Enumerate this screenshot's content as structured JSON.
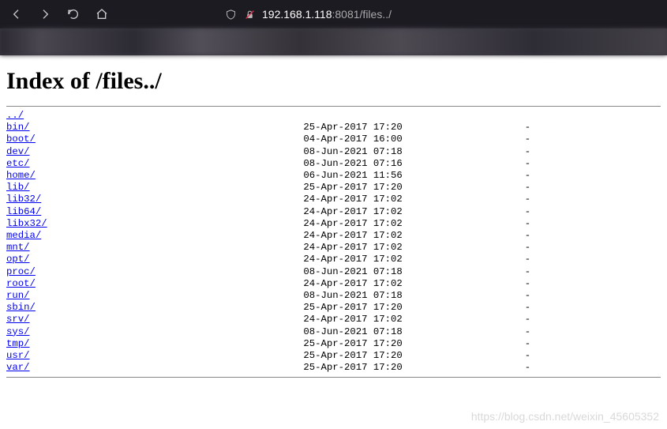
{
  "url": {
    "host": "192.168.1.118",
    "port": ":8081",
    "path": "/files../"
  },
  "page": {
    "title": "Index of /files../",
    "parent_label": "../"
  },
  "entries": [
    {
      "name": "bin/",
      "date": "25-Apr-2017 17:20",
      "size": "-"
    },
    {
      "name": "boot/",
      "date": "04-Apr-2017 16:00",
      "size": "-"
    },
    {
      "name": "dev/",
      "date": "08-Jun-2021 07:18",
      "size": "-"
    },
    {
      "name": "etc/",
      "date": "08-Jun-2021 07:16",
      "size": "-"
    },
    {
      "name": "home/",
      "date": "06-Jun-2021 11:56",
      "size": "-"
    },
    {
      "name": "lib/",
      "date": "25-Apr-2017 17:20",
      "size": "-"
    },
    {
      "name": "lib32/",
      "date": "24-Apr-2017 17:02",
      "size": "-"
    },
    {
      "name": "lib64/",
      "date": "24-Apr-2017 17:02",
      "size": "-"
    },
    {
      "name": "libx32/",
      "date": "24-Apr-2017 17:02",
      "size": "-"
    },
    {
      "name": "media/",
      "date": "24-Apr-2017 17:02",
      "size": "-"
    },
    {
      "name": "mnt/",
      "date": "24-Apr-2017 17:02",
      "size": "-"
    },
    {
      "name": "opt/",
      "date": "24-Apr-2017 17:02",
      "size": "-"
    },
    {
      "name": "proc/",
      "date": "08-Jun-2021 07:18",
      "size": "-"
    },
    {
      "name": "root/",
      "date": "24-Apr-2017 17:02",
      "size": "-"
    },
    {
      "name": "run/",
      "date": "08-Jun-2021 07:18",
      "size": "-"
    },
    {
      "name": "sbin/",
      "date": "25-Apr-2017 17:20",
      "size": "-"
    },
    {
      "name": "srv/",
      "date": "24-Apr-2017 17:02",
      "size": "-"
    },
    {
      "name": "sys/",
      "date": "08-Jun-2021 07:18",
      "size": "-"
    },
    {
      "name": "tmp/",
      "date": "25-Apr-2017 17:20",
      "size": "-"
    },
    {
      "name": "usr/",
      "date": "25-Apr-2017 17:20",
      "size": "-"
    },
    {
      "name": "var/",
      "date": "25-Apr-2017 17:20",
      "size": "-"
    }
  ],
  "layout": {
    "name_col_width": 51,
    "date_col_width": 20,
    "size_col_width": 19
  },
  "watermark": "https://blog.csdn.net/weixin_45605352"
}
